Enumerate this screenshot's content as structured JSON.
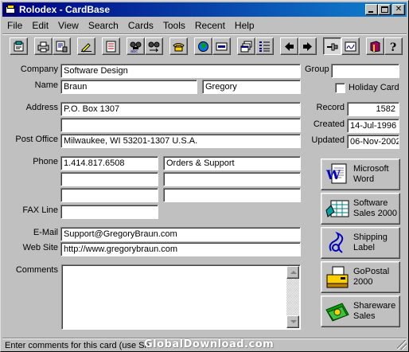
{
  "window": {
    "title": "Rolodex - CardBase",
    "controls": [
      "minimize",
      "maximize",
      "close"
    ]
  },
  "menu": [
    "File",
    "Edit",
    "View",
    "Search",
    "Cards",
    "Tools",
    "Recent",
    "Help"
  ],
  "toolbar": {
    "icons": [
      "new-card-icon",
      "print-icon",
      "print-setup-icon",
      "edit-icon",
      "checklist-icon",
      "find-icon",
      "sort-abc-icon",
      "phone-icon",
      "globe-icon",
      "card-icon",
      "cascade-windows-icon",
      "list-icon",
      "previous-arrow-icon",
      "next-arrow-icon",
      "pin-icon",
      "signature-icon",
      "book-icon",
      "help-icon"
    ]
  },
  "labels": {
    "company": "Company",
    "name": "Name",
    "address": "Address",
    "post_office": "Post Office",
    "phone": "Phone",
    "fax": "FAX Line",
    "email": "E-Mail",
    "website": "Web Site",
    "comments": "Comments",
    "group": "Group",
    "holiday": "Holiday Card",
    "record": "Record",
    "created": "Created",
    "updated": "Updated"
  },
  "fields": {
    "company": "Software Design",
    "last_name": "Braun",
    "first_name": "Gregory",
    "address1": "P.O. Box 1307",
    "address2": "",
    "post_office": "Milwaukee, WI  53201-1307  U.S.A.",
    "phone1": "1.414.817.6508",
    "phone1_desc": "Orders & Support",
    "phone2": "",
    "phone2_desc": "",
    "phone3": "",
    "phone3_desc": "",
    "fax": "",
    "email": "Support@GregoryBraun.com",
    "website": "http://www.gregorybraun.com",
    "comments": "",
    "group": "",
    "holiday_checked": false,
    "record": "1582",
    "created": "14-Jul-1996",
    "updated": "06-Nov-2002"
  },
  "side_buttons": [
    {
      "line1": "Microsoft",
      "line2": "Word",
      "icon": "word-document-icon"
    },
    {
      "line1": "Software",
      "line2": "Sales 2000",
      "icon": "spreadsheet-icon"
    },
    {
      "line1": "Shipping",
      "line2": "Label",
      "icon": "shipping-label-icon"
    },
    {
      "line1": "GoPostal",
      "line2": "2000",
      "icon": "postal-printer-icon"
    },
    {
      "line1": "Shareware",
      "line2": "Sales",
      "icon": "money-icon"
    }
  ],
  "status": {
    "text": "Enter comments for this card (use Sh",
    "watermark": "GlobalDownload.com"
  },
  "colors": {
    "face": "#c0c0c0",
    "title_start": "#000080",
    "title_end": "#1084d0"
  }
}
